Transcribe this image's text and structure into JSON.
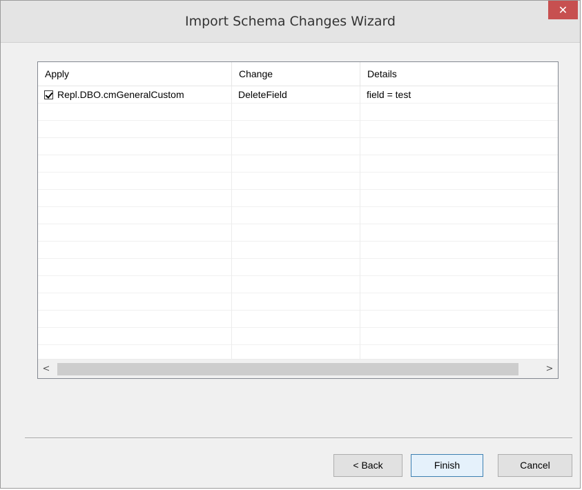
{
  "window": {
    "title": "Import Schema Changes Wizard",
    "close_glyph": "✕"
  },
  "grid": {
    "columns": [
      "Apply",
      "Change",
      "Details"
    ],
    "rows": [
      {
        "apply": "Repl.DBO.cmGeneralCustom",
        "checked": true,
        "change": "DeleteField",
        "details": "field = test"
      }
    ],
    "scroll_left_glyph": "<",
    "scroll_right_glyph": ">"
  },
  "buttons": {
    "back": "< Back",
    "finish": "Finish",
    "cancel": "Cancel"
  },
  "colors": {
    "close_button": "#c75050",
    "default_button_border": "#3c7fb1"
  },
  "icons": {
    "close": "close-icon",
    "checkbox": "checkbox-checked-icon",
    "scroll_left": "chevron-left-icon",
    "scroll_right": "chevron-right-icon"
  }
}
